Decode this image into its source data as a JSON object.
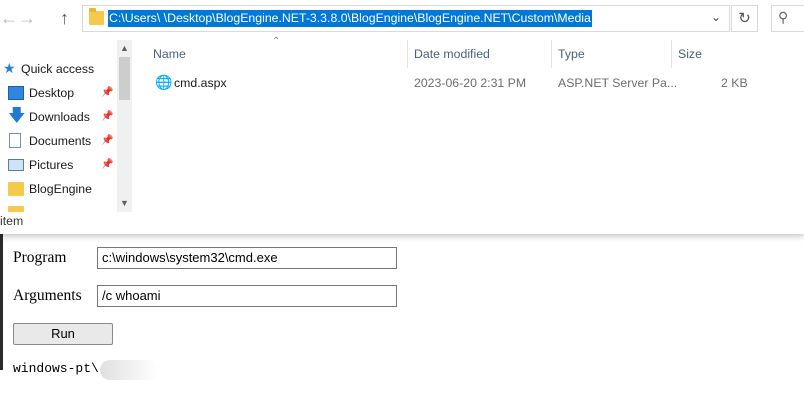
{
  "explorer": {
    "address": "C:\\Users\\      \\Desktop\\BlogEngine.NET-3.3.8.0\\BlogEngine\\BlogEngine.NET\\Custom\\Media",
    "nav_buttons": {
      "back": "←",
      "forward": "→",
      "up": "↑"
    },
    "nav_pane": [
      {
        "label": "Quick access",
        "icon": "star-icon",
        "pinned": false
      },
      {
        "label": "Desktop",
        "icon": "desktop-folder-icon",
        "pinned": true
      },
      {
        "label": "Downloads",
        "icon": "download-icon",
        "pinned": true
      },
      {
        "label": "Documents",
        "icon": "documents-icon",
        "pinned": true
      },
      {
        "label": "Pictures",
        "icon": "pictures-icon",
        "pinned": true
      },
      {
        "label": "BlogEngine",
        "icon": "folder-icon",
        "pinned": false
      }
    ],
    "columns": {
      "name": "Name",
      "date": "Date modified",
      "type": "Type",
      "size": "Size"
    },
    "files": [
      {
        "name": "cmd.aspx",
        "date": "2023-06-20 2:31 PM",
        "type": "ASP.NET Server Pa...",
        "size": "2 KB",
        "icon": "globe-icon"
      }
    ],
    "status": "item"
  },
  "form": {
    "program_label": "Program",
    "program_value": "c:\\windows\\system32\\cmd.exe",
    "arguments_label": "Arguments",
    "arguments_value": "/c whoami",
    "run_label": "Run",
    "output": "windows-pt\\"
  },
  "colors": {
    "selection": "#0078d7",
    "folder": "#f5c94b",
    "accent": "#0078d7"
  }
}
